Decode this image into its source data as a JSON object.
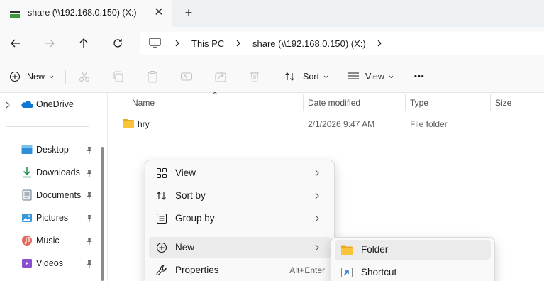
{
  "tab": {
    "title": "share (\\\\192.168.0.150) (X:)",
    "close_label": "✕",
    "new_tab_label": "+"
  },
  "address": {
    "breadcrumbs": [
      "This PC",
      "share (\\\\192.168.0.150) (X:)"
    ]
  },
  "toolbar": {
    "new_label": "New",
    "sort_label": "Sort",
    "view_label": "View",
    "more_label": "•••"
  },
  "nav": {
    "onedrive": "OneDrive",
    "items": [
      {
        "label": "Desktop",
        "icon": "desktop-icon"
      },
      {
        "label": "Downloads",
        "icon": "downloads-icon"
      },
      {
        "label": "Documents",
        "icon": "documents-icon"
      },
      {
        "label": "Pictures",
        "icon": "pictures-icon"
      },
      {
        "label": "Music",
        "icon": "music-icon"
      },
      {
        "label": "Videos",
        "icon": "videos-icon"
      }
    ]
  },
  "columns": {
    "name": "Name",
    "date": "Date modified",
    "type": "Type",
    "size": "Size"
  },
  "files": [
    {
      "name": "hry",
      "date": "2/1/2026 9:47 AM",
      "type": "File folder",
      "size": ""
    }
  ],
  "context_menu": {
    "items": [
      {
        "label": "View",
        "icon": "grid-icon",
        "submenu": true
      },
      {
        "label": "Sort by",
        "icon": "sort-icon",
        "submenu": true
      },
      {
        "label": "Group by",
        "icon": "group-icon",
        "submenu": true
      },
      {
        "label": "New",
        "icon": "plus-circle-icon",
        "submenu": true,
        "selected": true
      },
      {
        "label": "Properties",
        "icon": "wrench-icon",
        "shortcut": "Alt+Enter"
      }
    ]
  },
  "submenu": {
    "items": [
      {
        "label": "Folder",
        "icon": "folder-icon",
        "selected": true
      },
      {
        "label": "Shortcut",
        "icon": "shortcut-icon"
      }
    ]
  },
  "colors": {
    "accent": "#0067c0",
    "folder": "#f8c53a",
    "menu_bg": "#f9f9f9",
    "hover": "#ebebeb"
  }
}
